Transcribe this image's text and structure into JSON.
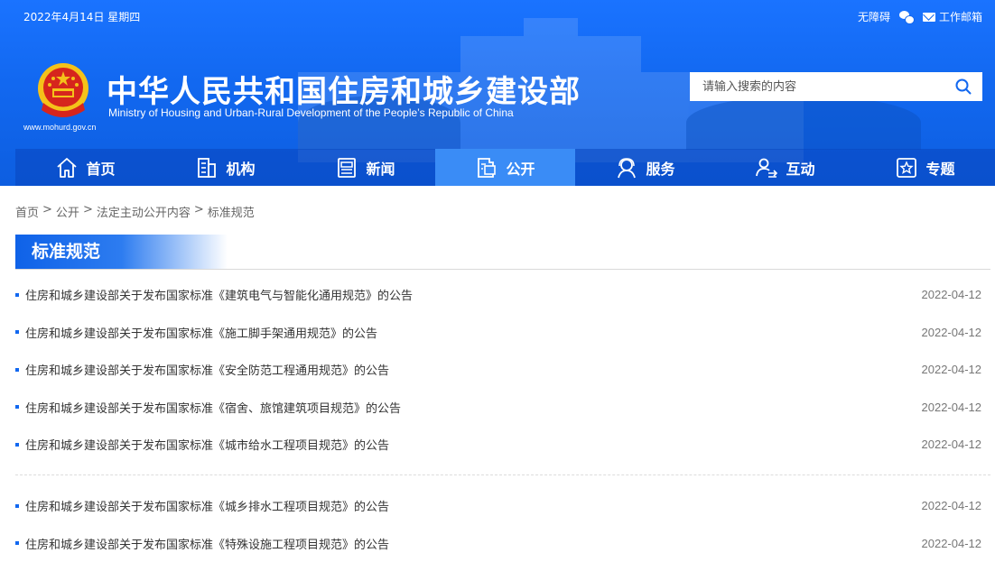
{
  "topbar": {
    "date": "2022年4月14日 星期四",
    "accessibility": "无障碍",
    "wechat_icon": "wechat-icon",
    "mail": "工作邮箱"
  },
  "site": {
    "title": "中华人民共和国住房和城乡建设部",
    "subtitle": "Ministry of Housing and Urban-Rural Development of the People’s Republic of China",
    "url": "www.mohurd.gov.cn"
  },
  "search": {
    "placeholder": "请输入搜索的内容"
  },
  "nav": [
    {
      "label": "首页",
      "icon": "home-icon"
    },
    {
      "label": "机构",
      "icon": "building-icon"
    },
    {
      "label": "新闻",
      "icon": "news-icon"
    },
    {
      "label": "公开",
      "icon": "document-icon",
      "active": true
    },
    {
      "label": "服务",
      "icon": "service-icon"
    },
    {
      "label": "互动",
      "icon": "interaction-icon"
    },
    {
      "label": "专题",
      "icon": "star-icon"
    }
  ],
  "breadcrumb": [
    "首页",
    "公开",
    "法定主动公开内容",
    "标准规范"
  ],
  "section": {
    "title": "标准规范"
  },
  "list_group_1": [
    {
      "title": "住房和城乡建设部关于发布国家标准《建筑电气与智能化通用规范》的公告",
      "date": "2022-04-12"
    },
    {
      "title": "住房和城乡建设部关于发布国家标准《施工脚手架通用规范》的公告",
      "date": "2022-04-12"
    },
    {
      "title": "住房和城乡建设部关于发布国家标准《安全防范工程通用规范》的公告",
      "date": "2022-04-12"
    },
    {
      "title": "住房和城乡建设部关于发布国家标准《宿舍、旅馆建筑项目规范》的公告",
      "date": "2022-04-12"
    },
    {
      "title": "住房和城乡建设部关于发布国家标准《城市给水工程项目规范》的公告",
      "date": "2022-04-12"
    }
  ],
  "list_group_2": [
    {
      "title": "住房和城乡建设部关于发布国家标准《城乡排水工程项目规范》的公告",
      "date": "2022-04-12"
    },
    {
      "title": "住房和城乡建设部关于发布国家标准《特殊设施工程项目规范》的公告",
      "date": "2022-04-12"
    }
  ],
  "colors": {
    "primary": "#1268f0",
    "nav_active": "#3a8cf6",
    "emblem_red": "#d6251d",
    "emblem_gold": "#f4c21a"
  }
}
